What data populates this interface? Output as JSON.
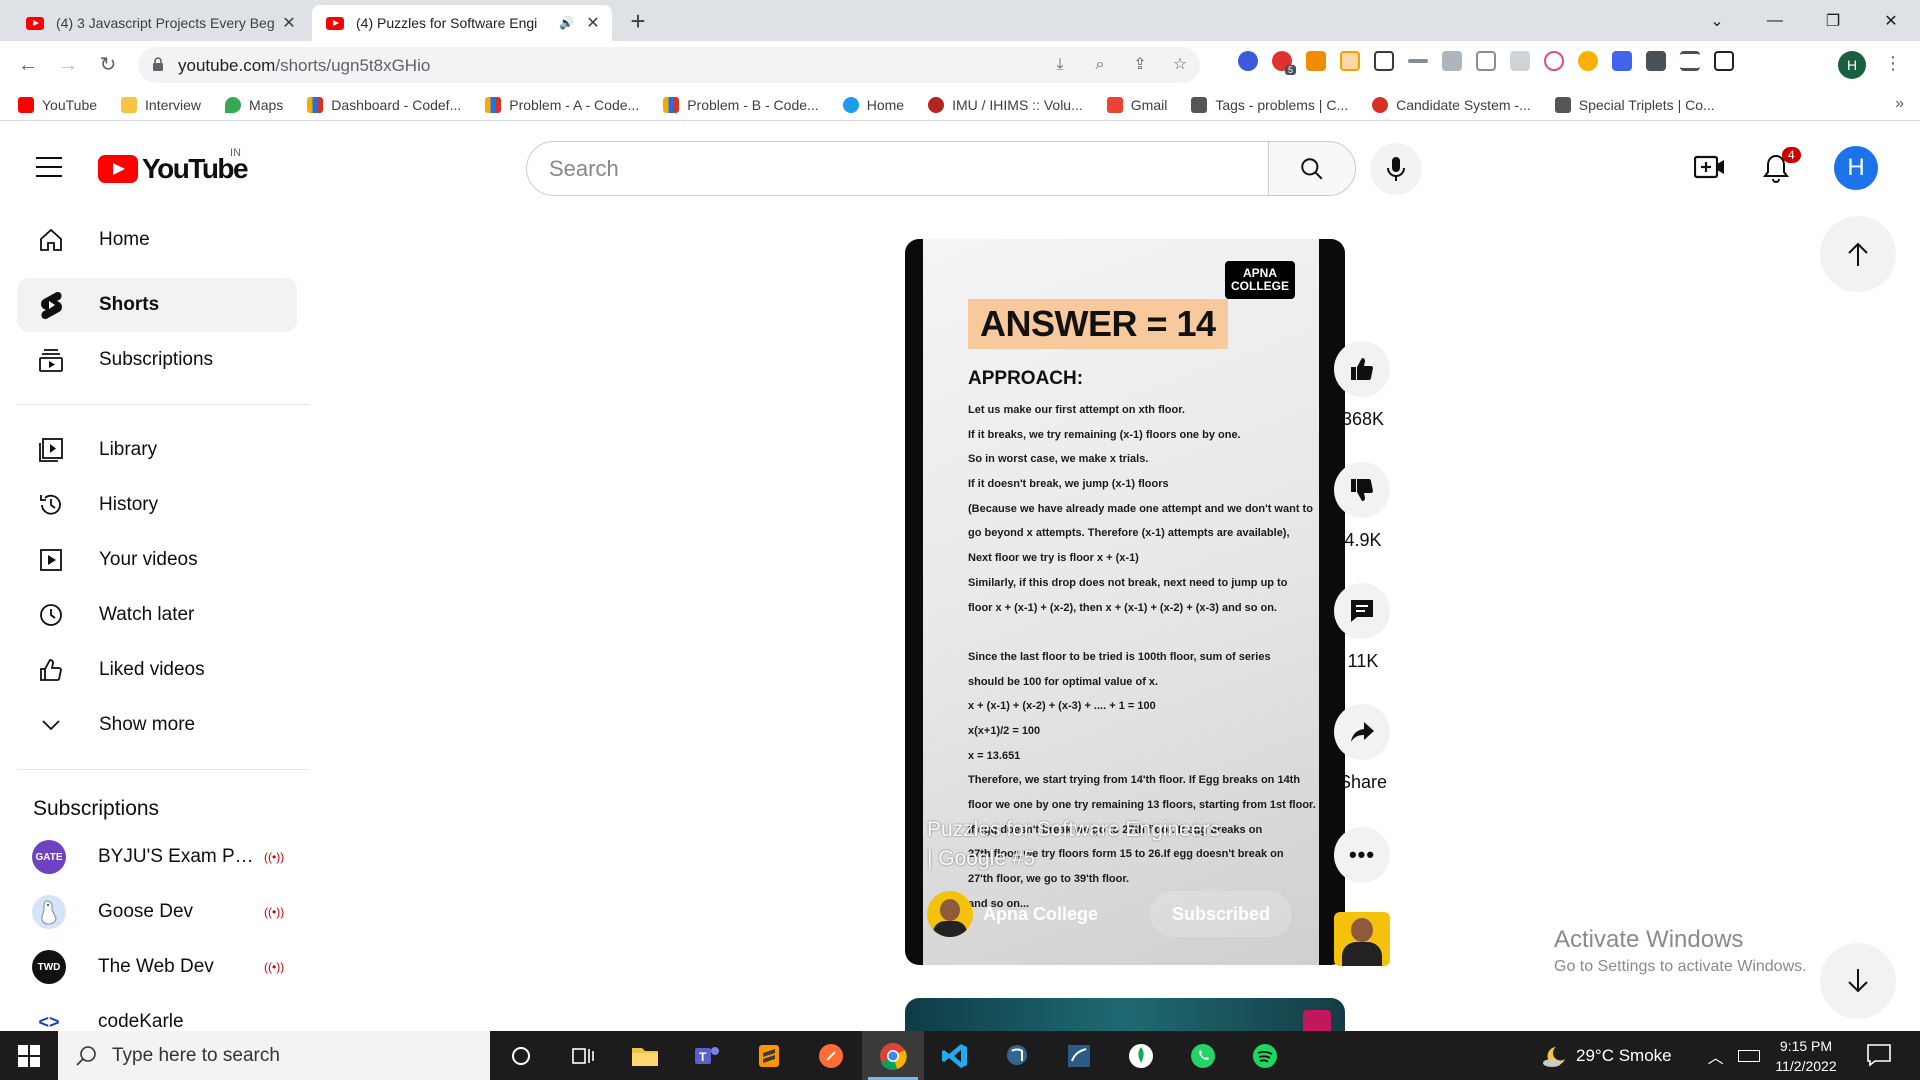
{
  "browser": {
    "tabs": [
      {
        "title": "(4) 3 Javascript Projects Every Beg",
        "active": false
      },
      {
        "title": "(4) Puzzles for Software Engi",
        "active": true,
        "audio": "🔊"
      }
    ],
    "url_host": "youtube.com",
    "url_path": "/shorts/ugn5t8xGHio",
    "profile_initial": "H",
    "ext_badge": "5",
    "bookmarks": [
      {
        "label": "YouTube",
        "color": "#ff0000"
      },
      {
        "label": "Interview",
        "color": "#f6c343"
      },
      {
        "label": "Maps",
        "color": "#34a853"
      },
      {
        "label": "Dashboard - Codef...",
        "color": "#f9ab00"
      },
      {
        "label": "Problem - A - Code...",
        "color": "#f9ab00"
      },
      {
        "label": "Problem - B - Code...",
        "color": "#f9ab00"
      },
      {
        "label": "Home",
        "color": "#1d9bf0"
      },
      {
        "label": "IMU / IHIMS :: Volu...",
        "color": "#b3261e"
      },
      {
        "label": "Gmail",
        "color": "#ea4335"
      },
      {
        "label": "Tags - problems | C...",
        "color": "#555555"
      },
      {
        "label": "Candidate System -...",
        "color": "#d93025"
      },
      {
        "label": "Special Triplets | Co...",
        "color": "#555555"
      }
    ],
    "bookmarks_more": "»"
  },
  "youtube": {
    "logo_word": "YouTube",
    "country_code": "IN",
    "search_placeholder": "Search",
    "notification_count": "4",
    "avatar_initial": "H"
  },
  "sidebar": {
    "primary": [
      {
        "label": "Home",
        "icon": "home-icon"
      },
      {
        "label": "Shorts",
        "icon": "shorts-icon",
        "active": true
      },
      {
        "label": "Subscriptions",
        "icon": "subscriptions-icon"
      }
    ],
    "secondary": [
      {
        "label": "Library",
        "icon": "library-icon"
      },
      {
        "label": "History",
        "icon": "history-icon"
      },
      {
        "label": "Your videos",
        "icon": "your-videos-icon"
      },
      {
        "label": "Watch later",
        "icon": "watch-later-icon"
      },
      {
        "label": "Liked videos",
        "icon": "liked-videos-icon"
      },
      {
        "label": "Show more",
        "icon": "chevron-down-icon"
      }
    ],
    "subscriptions_heading": "Subscriptions",
    "subscriptions": [
      {
        "name": "BYJU'S Exam Pre...",
        "avatar_text": "GATE",
        "color": "#6f42c1",
        "live": "((•))"
      },
      {
        "name": "Goose Dev",
        "avatar_text": "",
        "color": "#d6e4f7",
        "live": "((•))"
      },
      {
        "name": "The Web Dev",
        "avatar_text": "TWD",
        "color": "#111111",
        "live": "((•))"
      },
      {
        "name": "codeKarle",
        "avatar_text": "<>",
        "color": "#ffffff",
        "live": ""
      }
    ]
  },
  "short": {
    "brand_badge_line1": "APNA",
    "brand_badge_line2": "COLLEGE",
    "answer": "ANSWER = 14",
    "approach_heading": "APPROACH:",
    "steps": [
      "Let us make our first attempt on xth floor.",
      "If it breaks, we try remaining (x-1) floors one by one.",
      "So in worst case, we make x trials.",
      "If it doesn't break, we jump (x-1) floors",
      "(Because we have already made one attempt and we don't want to",
      " go beyond x attempts.  Therefore (x-1) attempts are available),",
      "Next floor we try is floor x + (x-1)",
      "Similarly, if this drop does not break, next need to jump up to",
      "floor x + (x-1) + (x-2), then x + (x-1) + (x-2) + (x-3) and so on.",
      "",
      "Since the last floor to be tried is 100th floor, sum of series",
      "should be 100 for optimal value of x.",
      "x + (x-1) + (x-2) + (x-3) + .... + 1  = 100",
      "x(x+1)/2  = 100",
      "x = 13.651",
      "Therefore, we start trying from 14'th floor. If Egg breaks on 14th",
      "floor we one by one try remaining 13 floors, starting from 1st floor.",
      "If egg doesn't break we go to 27th floor. If egg breaks on",
      "27th floor, we try floors form 15 to 26.If egg doesn't break on",
      "27'th floor, we go to 39'th floor.",
      "and so on..."
    ],
    "title": "Puzzles for Software Engineers | Google #5",
    "channel": "Apna College",
    "subscribe_label": "Subscribed"
  },
  "actions": {
    "likes": "368K",
    "dislike_label": "4.9K",
    "comments": "11K",
    "share_label": "Share"
  },
  "watermark": {
    "line1": "Activate Windows",
    "line2": "Go to Settings to activate Windows."
  },
  "taskbar": {
    "search_placeholder": "Type here to search",
    "weather": "29°C  Smoke",
    "time": "9:15 PM",
    "date": "11/2/2022"
  }
}
